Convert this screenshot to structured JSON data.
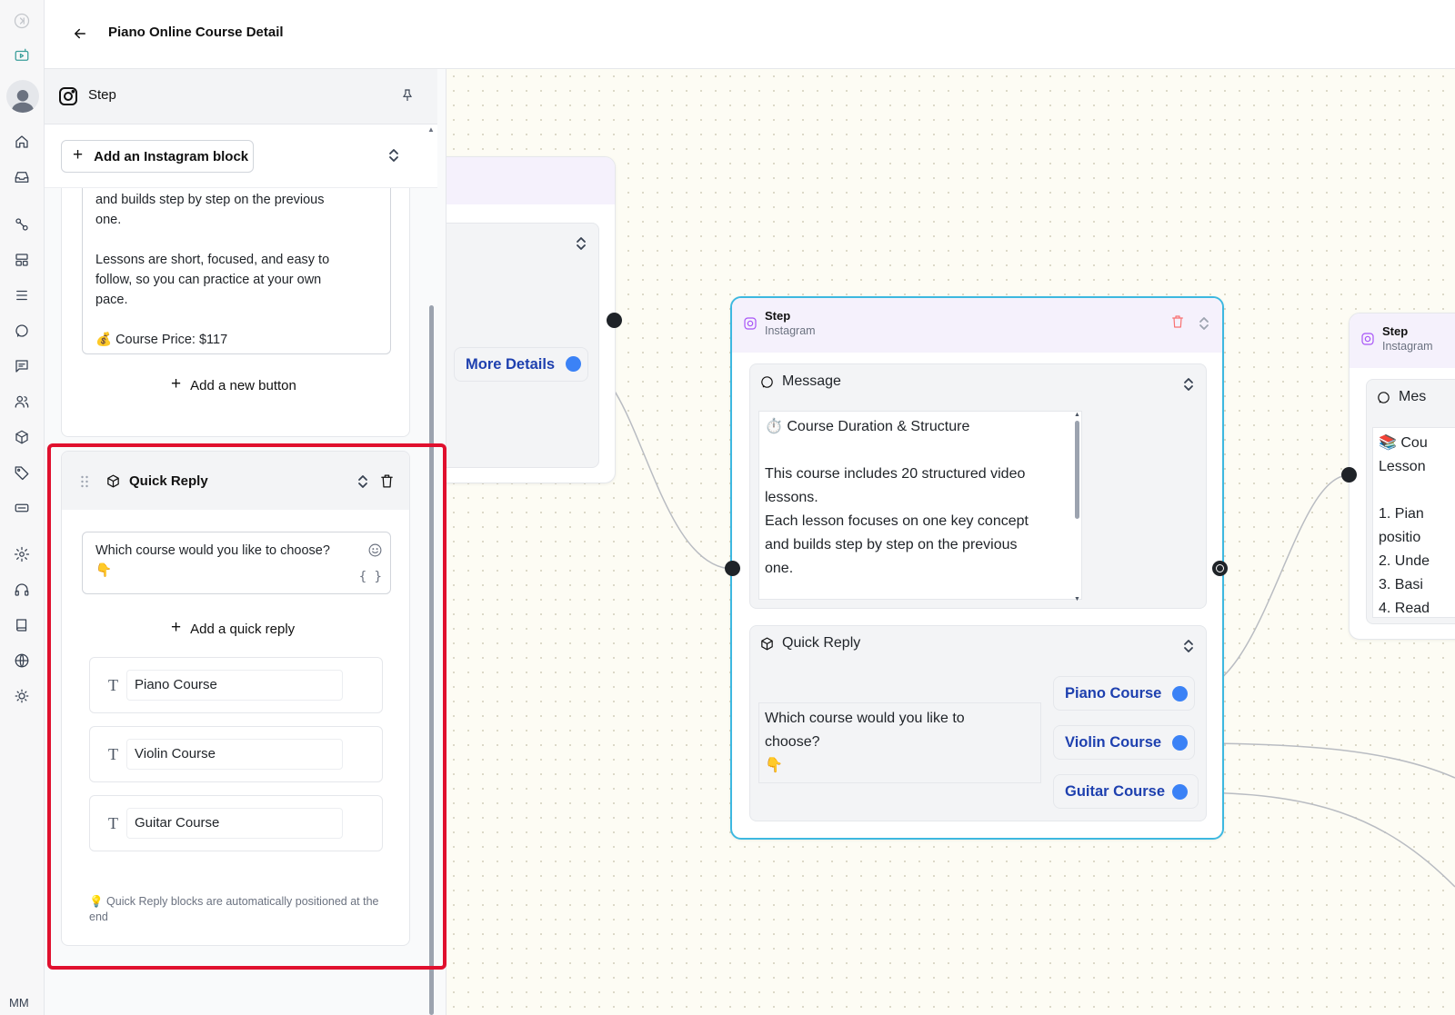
{
  "header": {
    "title": "Piano Online Course Detail"
  },
  "rail": {
    "icons": [
      "sidebar-toggle-icon",
      "chatbot-icon",
      "avatar",
      "home-icon",
      "inbox-icon",
      "flow-icon",
      "layout-icon",
      "list-icon",
      "chat-icon",
      "message-square-icon",
      "contacts-icon",
      "package-icon",
      "tag-icon",
      "ticket-icon",
      "settings-icon",
      "headset-icon",
      "book-icon",
      "globe-icon",
      "sun-icon"
    ],
    "initials": "MM"
  },
  "panel": {
    "header_label": "Step",
    "add_block_label": "Add an Instagram block",
    "message_text": "and builds step by step on the previous\none.\n\nLessons are short, focused, and easy to\nfollow, so you can practice at your own\npace.\n\n💰 Course Price: $117",
    "add_button_label": "Add a new button",
    "quick_reply": {
      "title": "Quick Reply",
      "text": "Which course would you like to choose?",
      "text_emoji": "👇",
      "braces": "{ }",
      "add_label": "Add a quick reply",
      "options": [
        "Piano Course",
        "Violin Course",
        "Guitar Course"
      ],
      "note": "💡 Quick Reply blocks are automatically positioned at the end"
    }
  },
  "canvas": {
    "left_node": {
      "button_label": "More Details"
    },
    "main_node": {
      "title": "Step",
      "subtitle": "Instagram",
      "message_label": "Message",
      "message_text": "⏱️ Course Duration & Structure\n\nThis course includes 20 structured video\nlessons.\nEach lesson focuses on one key concept\nand builds step by step on the previous\none.",
      "quick_reply_label": "Quick Reply",
      "quick_reply_text": "Which course would you like to\nchoose?\n👇",
      "options": [
        "Piano Course",
        "Violin Course",
        "Guitar Course"
      ]
    },
    "right_node": {
      "title": "Step",
      "subtitle": "Instagram",
      "message_label": "Mes",
      "message_text": "📚 Cou\nLesson\n\n1. Pian\npositio\n2. Unde\n3. Basi\n4. Read"
    }
  },
  "colors": {
    "highlight": "#e0102e",
    "accent": "#3b82f6",
    "selected_border": "#3db8e0",
    "option_text": "#1e40af"
  }
}
